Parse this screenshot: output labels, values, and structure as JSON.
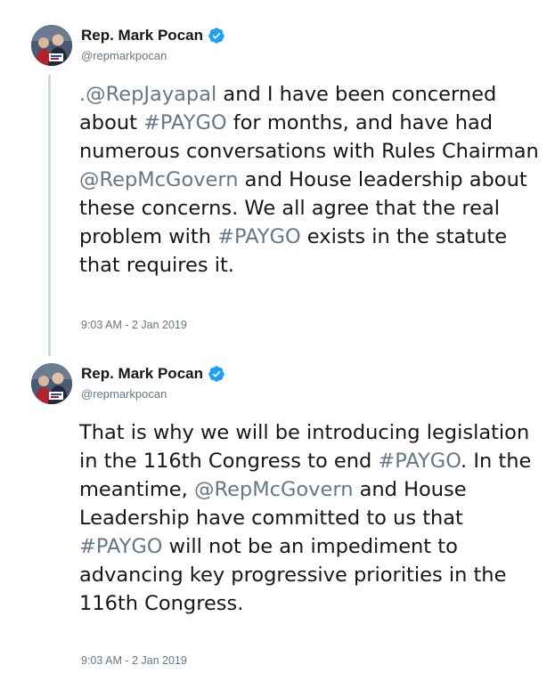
{
  "tweets": [
    {
      "display_name": "Rep. Mark Pocan",
      "handle": "@repmarkpocan",
      "verified": true,
      "avatar": "profile-photo",
      "text_segments": [
        {
          "text": ".@RepJayapal",
          "link": true
        },
        {
          "text": " and I have been concerned about ",
          "link": false
        },
        {
          "text": "#PAYGO",
          "link": true
        },
        {
          "text": " for months, and have had numerous conversations with Rules Chairman ",
          "link": false
        },
        {
          "text": "@RepMcGovern",
          "link": true
        },
        {
          "text": " and House leadership about these concerns. We all agree that the real problem with ",
          "link": false
        },
        {
          "text": "#PAYGO",
          "link": true
        },
        {
          "text": " exists in the statute that requires it.",
          "link": false
        }
      ],
      "timestamp": "9:03 AM - 2 Jan 2019"
    },
    {
      "display_name": "Rep. Mark Pocan",
      "handle": "@repmarkpocan",
      "verified": true,
      "avatar": "profile-photo",
      "text_segments": [
        {
          "text": "That is why we will be introducing legislation in the 116th Congress to end ",
          "link": false
        },
        {
          "text": "#PAYGO",
          "link": true
        },
        {
          "text": ". In the meantime, ",
          "link": false
        },
        {
          "text": "@RepMcGovern",
          "link": true
        },
        {
          "text": " and House Leadership have committed to us that ",
          "link": false
        },
        {
          "text": "#PAYGO",
          "link": true
        },
        {
          "text": " will not be an impediment to advancing key progressive priorities in the 116th Congress.",
          "link": false
        }
      ],
      "timestamp": "9:03 AM - 2 Jan 2019"
    }
  ],
  "colors": {
    "text": "#14171a",
    "secondary": "#657786",
    "verified_blue": "#1da1f2",
    "thread_line": "#cfd9de"
  },
  "icons": {
    "verified": "verified-badge-icon"
  }
}
